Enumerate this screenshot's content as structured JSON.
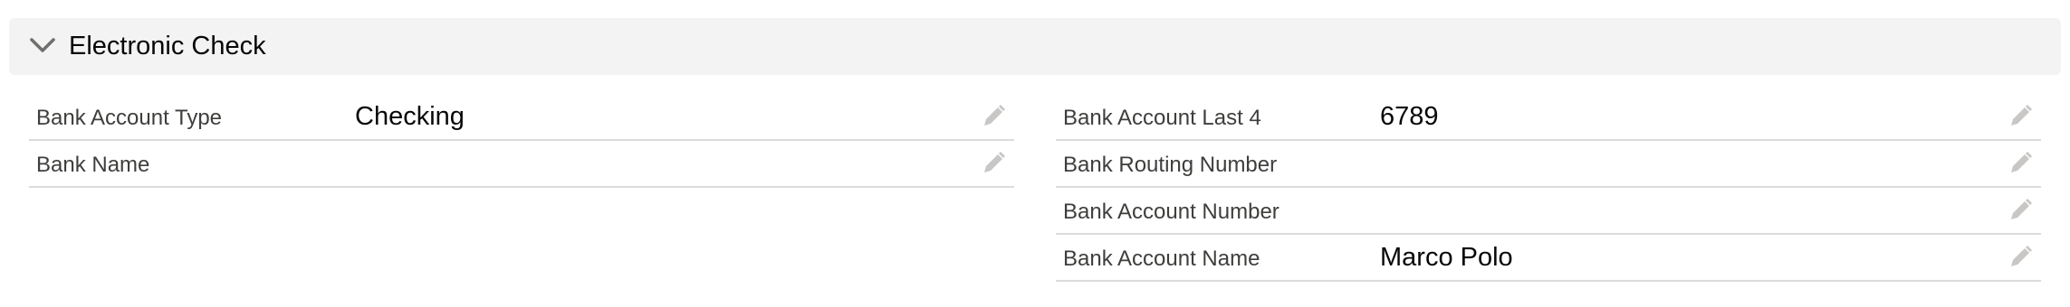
{
  "section": {
    "title": "Electronic Check",
    "toggle_icon": "chevron-down-icon"
  },
  "left_fields": [
    {
      "label": "Bank Account Type",
      "value": "Checking",
      "edit_icon": "pencil-icon"
    },
    {
      "label": "Bank Name",
      "value": "",
      "edit_icon": "pencil-icon"
    }
  ],
  "right_fields": [
    {
      "label": "Bank Account Last 4",
      "value": "6789",
      "edit_icon": "pencil-icon"
    },
    {
      "label": "Bank Routing Number",
      "value": "",
      "edit_icon": "pencil-icon"
    },
    {
      "label": "Bank Account Number",
      "value": "",
      "edit_icon": "pencil-icon"
    },
    {
      "label": "Bank Account Name",
      "value": "Marco Polo",
      "edit_icon": "pencil-icon"
    }
  ],
  "colors": {
    "header_bg": "#f3f3f3",
    "divider": "#dddbda",
    "label": "#3e3e3c",
    "value": "#080707",
    "icon": "#c9c7c5"
  }
}
